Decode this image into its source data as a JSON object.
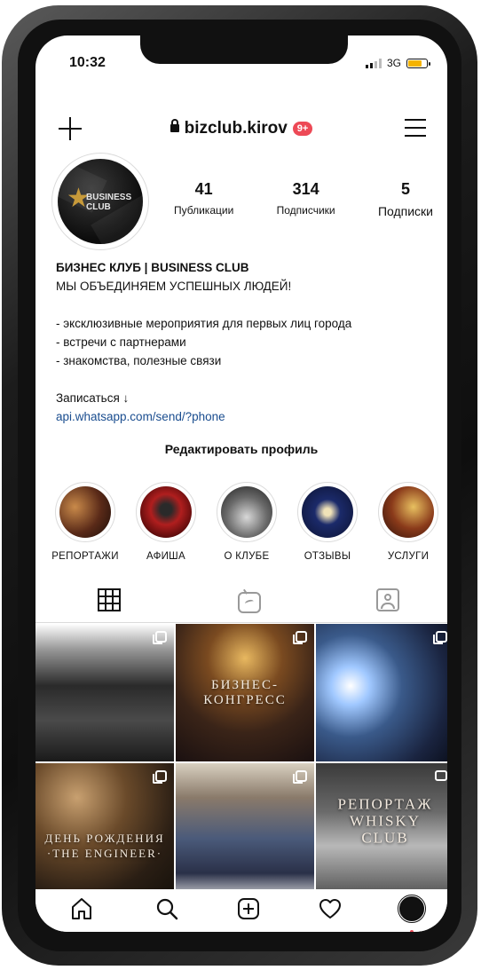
{
  "status_bar": {
    "time": "10:32",
    "network": "3G"
  },
  "profile": {
    "username": "bizclub.kirov",
    "notification_badge": "9+",
    "avatar_text": "BUSINESS CLUB",
    "stats": [
      {
        "value": "41",
        "label": "Публикации"
      },
      {
        "value": "314",
        "label": "Подписчики"
      },
      {
        "value": "5",
        "label": "Подписки"
      }
    ],
    "bio": {
      "name": "БИЗНЕС КЛУБ | BUSINESS CLUB",
      "tagline": "МЫ ОБЪЕДИНЯЕМ УСПЕШНЫХ ЛЮДЕЙ!",
      "lines": [
        "- эксклюзивные мероприятия для первых лиц города",
        "- встречи с партнерами",
        "- знакомства, полезные связи"
      ],
      "cta": "Записаться ↓",
      "link": "api.whatsapp.com/send/?phone"
    },
    "edit_button": "Редактировать профиль"
  },
  "highlights": [
    {
      "label": "РЕПОРТАЖИ"
    },
    {
      "label": "АФИША"
    },
    {
      "label": "О КЛУБЕ"
    },
    {
      "label": "ОТЗЫВЫ"
    },
    {
      "label": "УСЛУГИ"
    }
  ],
  "posts": [
    {
      "caption": ""
    },
    {
      "caption": "БИЗНЕС-\nКОНГРЕСС"
    },
    {
      "caption": ""
    },
    {
      "caption": "ДЕНЬ РОЖДЕНИЯ\n·THE ENGINEER·"
    },
    {
      "caption": ""
    },
    {
      "caption": "РЕПОРТАЖ\nWHISKY\nCLUB"
    }
  ],
  "colors": {
    "badge": "#ed4956",
    "link": "#1a4d8f",
    "battery": "#f5b300"
  },
  "icons": [
    "plus-icon",
    "lock-icon",
    "menu-icon",
    "grid-tab-icon",
    "igtv-tab-icon",
    "tagged-tab-icon",
    "home-icon",
    "search-icon",
    "add-post-icon",
    "heart-icon",
    "profile-icon"
  ]
}
